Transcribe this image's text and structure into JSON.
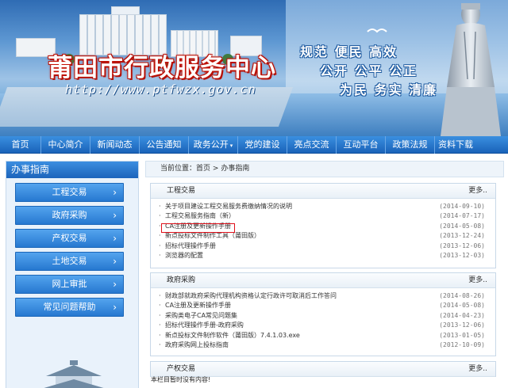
{
  "banner": {
    "title": "莆田市行政服务中心",
    "url": "http://www.ptfwzx.gov.cn",
    "slogans": [
      "规范 便民 高效",
      "公开 公平 公正",
      "为民 务实 清廉"
    ]
  },
  "nav": {
    "items": [
      "首页",
      "中心简介",
      "新闻动态",
      "公告通知",
      "政务公开",
      "党的建设",
      "亮点交流",
      "互动平台",
      "政策法规",
      "资料下载"
    ]
  },
  "sidebar": {
    "title": "办事指南",
    "items": [
      "工程交易",
      "政府采购",
      "产权交易",
      "土地交易",
      "网上审批",
      "常见问题帮助"
    ],
    "arrow": "›"
  },
  "breadcrumb": {
    "label": "当前位置：",
    "home": "首页",
    "sep": ">",
    "current": "办事指南"
  },
  "sections": [
    {
      "title": "工程交易",
      "more": "更多..",
      "rows": [
        {
          "text": "关于项目建设工程交易服务费缴纳情况的说明",
          "date": "(2014-09-10)"
        },
        {
          "text": "工程交易服务指南（新）",
          "date": "(2014-07-17)"
        },
        {
          "text": "CA注册及更新操作手册",
          "date": "(2014-05-08)"
        },
        {
          "text": "新点投标文件制作工具（莆田版）",
          "date": "(2013-12-24)"
        },
        {
          "text": "招标代理操作手册",
          "date": "(2013-12-06)"
        },
        {
          "text": "浏览器的配置",
          "date": "(2013-12-03)"
        }
      ]
    },
    {
      "title": "政府采购",
      "more": "更多..",
      "rows": [
        {
          "text": "财政部就政府采购代理机构资格认定行政许可取消后工作答问",
          "date": "(2014-08-26)"
        },
        {
          "text": "CA注册及更新操作手册",
          "date": "(2014-05-08)"
        },
        {
          "text": "采购类电子CA常见问题集",
          "date": "(2014-04-23)"
        },
        {
          "text": "招标代理操作手册-政府采购",
          "date": "(2013-12-06)"
        },
        {
          "text": "新点投标文件制作软件（莆田版）7.4.1.03.exe",
          "date": "(2013-01-05)"
        },
        {
          "text": "政府采购网上投标指南",
          "date": "(2012-10-09)"
        }
      ]
    },
    {
      "title": "产权交易",
      "more": "更多.."
    }
  ],
  "empty_notice": "本栏目暂时没有内容!",
  "colors": {
    "nav": "#1a63b9",
    "highlight_box": "#e0101a",
    "title_red": "#b0120a"
  }
}
